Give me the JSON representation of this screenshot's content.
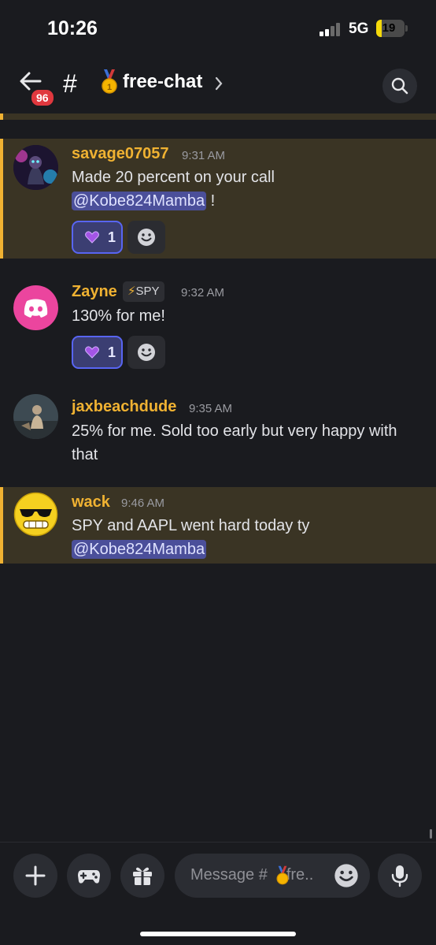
{
  "status_bar": {
    "time": "10:26",
    "network": "5G",
    "battery": "19",
    "battery_fraction": 0.19
  },
  "header": {
    "unread_badge": "96",
    "channel_name": "free-chat",
    "channel_emoji": "medal-icon"
  },
  "messages": [
    {
      "username": "savage07057",
      "time": "9:31 AM",
      "text_before": "Made 20 percent on your call",
      "mention": "@Kobe824Mamba",
      "text_after": " !",
      "reaction": {
        "emoji": "purple-heart",
        "count": "1"
      },
      "highlighted": true
    },
    {
      "username": "Zayne",
      "tag": "SPY",
      "tag_icon": "lightning-icon",
      "time": "9:32 AM",
      "text": "130% for me!",
      "reaction": {
        "emoji": "purple-heart",
        "count": "1"
      },
      "highlighted": false
    },
    {
      "username": "jaxbeachdude",
      "time": "9:35 AM",
      "text": "25% for me. Sold too early but very happy with that",
      "highlighted": false
    },
    {
      "username": "wack",
      "time": "9:46 AM",
      "text_before": "SPY and AAPL went hard today ty",
      "mention": "@Kobe824Mamba",
      "highlighted": true
    }
  ],
  "composer": {
    "placeholder_prefix": "Message #",
    "placeholder_suffix": "fre.."
  },
  "colors": {
    "background": "#1a1b1f",
    "mention_bg": "#3a3424",
    "mention_bar": "#f0b232",
    "username": "#f0b232",
    "reaction_border": "#5865f2",
    "badge": "#e0383e"
  }
}
